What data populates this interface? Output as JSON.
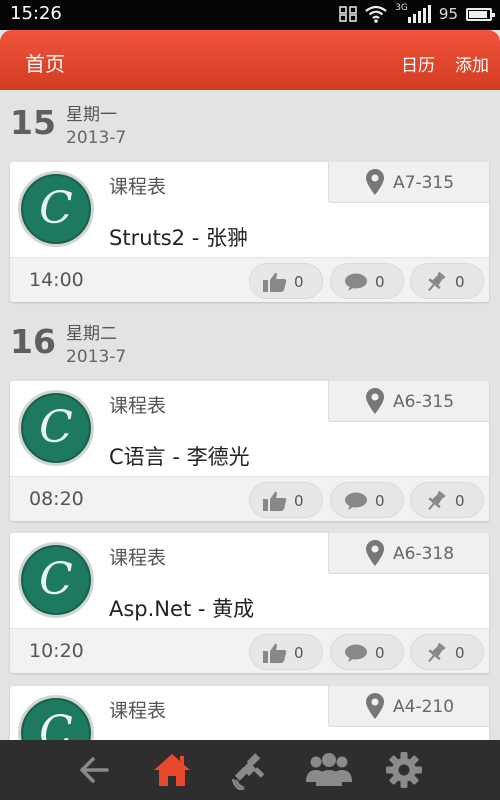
{
  "status_bar": {
    "time": "15:26",
    "battery": "95",
    "network": "3G"
  },
  "header": {
    "title": "首页",
    "calendar_label": "日历",
    "add_label": "添加"
  },
  "date_groups": [
    {
      "day": "15",
      "weekday": "星期一",
      "month": "2013-7"
    },
    {
      "day": "16",
      "weekday": "星期二",
      "month": "2013-7"
    }
  ],
  "cards": [
    {
      "avatar_letter": "C",
      "category": "课程表",
      "location": "A7-315",
      "title": "Struts2 - 张翀",
      "time": "14:00",
      "likes": "0",
      "comments": "0",
      "pins": "0"
    },
    {
      "avatar_letter": "C",
      "category": "课程表",
      "location": "A6-315",
      "title": "C语言 - 李德光",
      "time": "08:20",
      "likes": "0",
      "comments": "0",
      "pins": "0"
    },
    {
      "avatar_letter": "C",
      "category": "课程表",
      "location": "A6-318",
      "title": "Asp.Net - 黄成",
      "time": "10:20",
      "likes": "0",
      "comments": "0",
      "pins": "0"
    },
    {
      "avatar_letter": "C",
      "category": "课程表",
      "location": "A4-210",
      "title": "",
      "time": "",
      "likes": "",
      "comments": "",
      "pins": ""
    }
  ],
  "bottom_nav": {
    "active": "home",
    "items": [
      "back-arrow-icon",
      "home-icon",
      "satellite-icon",
      "group-icon",
      "gear-icon"
    ]
  },
  "colors": {
    "accent": "#e8482c",
    "avatar": "#1d7a60",
    "nav_bg": "#2e2e2e"
  }
}
